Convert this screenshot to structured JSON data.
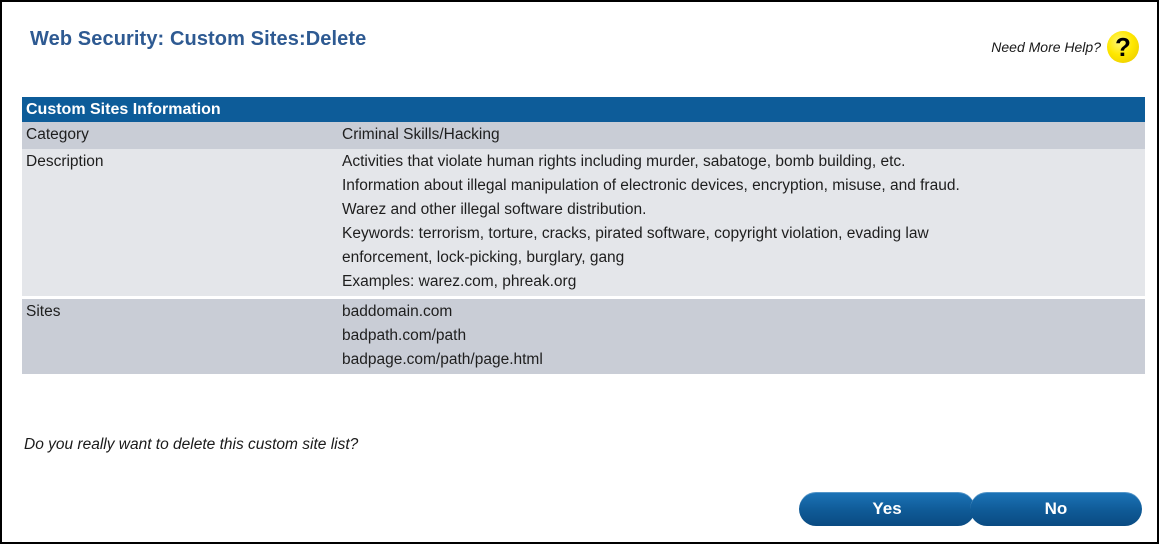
{
  "header": {
    "title": "Web Security: Custom Sites:Delete",
    "help_link": "Need More Help?",
    "help_icon_glyph": "?"
  },
  "info_table": {
    "heading": "Custom Sites Information",
    "rows": [
      {
        "label": "Category",
        "lines": [
          "Criminal Skills/Hacking"
        ]
      },
      {
        "label": "Description",
        "lines": [
          "Activities that violate human rights including murder, sabatoge, bomb building, etc.",
          "Information about illegal manipulation of electronic devices, encryption, misuse, and fraud.",
          "Warez and other illegal software distribution.",
          "Keywords: terrorism, torture, cracks, pirated software, copyright violation, evading law",
          "enforcement, lock-picking, burglary, gang",
          "Examples: warez.com, phreak.org"
        ]
      },
      {
        "label": "Sites",
        "lines": [
          "baddomain.com",
          "badpath.com/path",
          "badpage.com/path/page.html"
        ]
      }
    ]
  },
  "confirm": {
    "question": "Do you really want to delete this custom site list?"
  },
  "buttons": {
    "yes": "Yes",
    "no": "No"
  },
  "colors": {
    "title": "#2e5a92",
    "table_header": "#0d5c99",
    "row_dark": "#c9cdd6",
    "row_light": "#e4e6ea",
    "button": "#0f5a96",
    "help_icon": "#ffe800"
  }
}
